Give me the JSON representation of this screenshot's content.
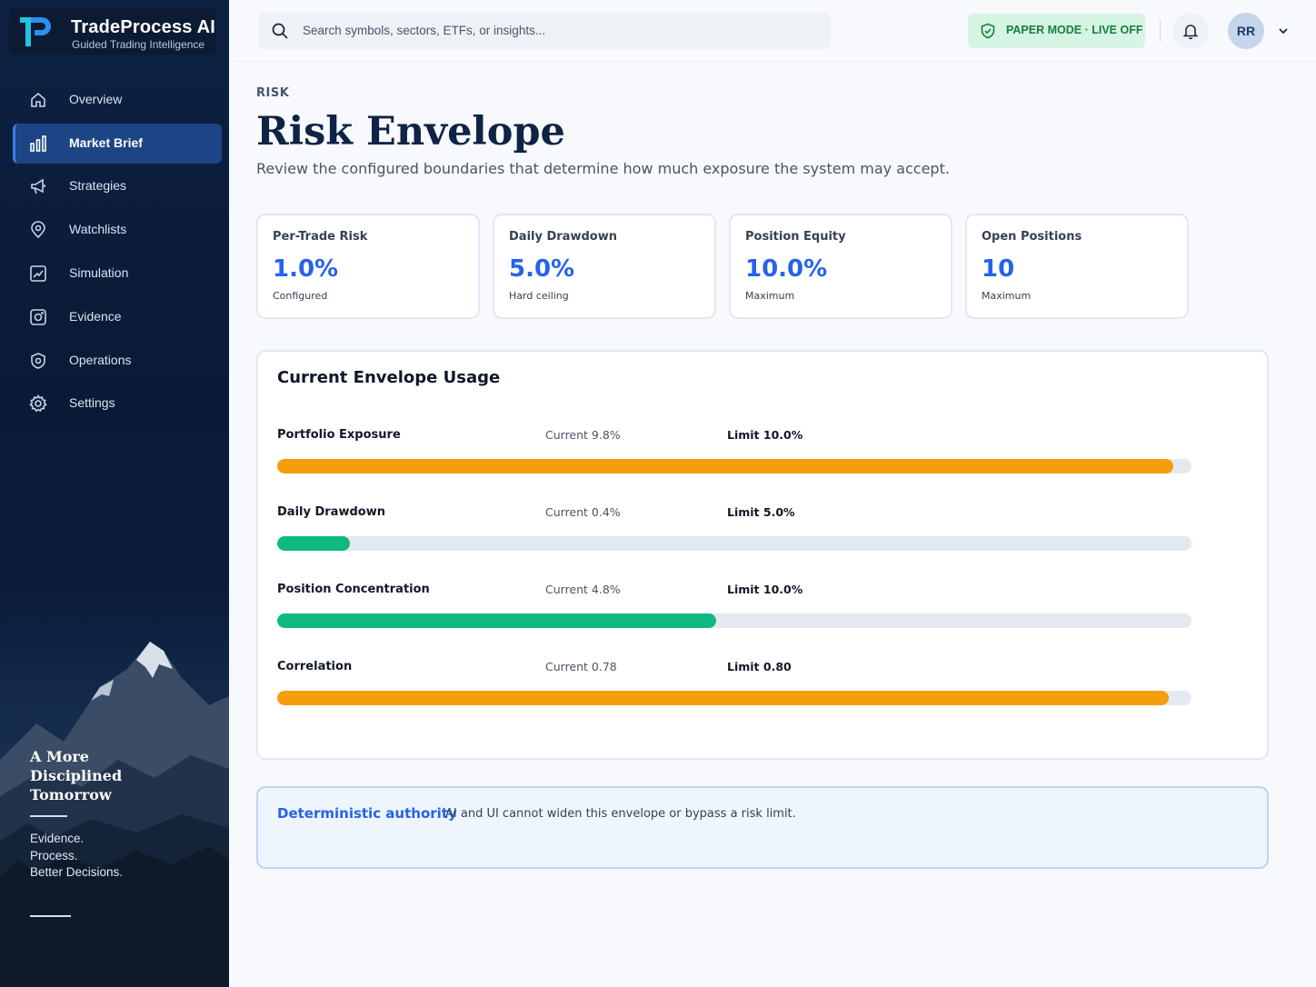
{
  "app": {
    "name": "TradeProcess AI",
    "tagline": "Guided Trading Intelligence"
  },
  "sidebar": {
    "items": [
      {
        "label": "Overview",
        "icon": "home-icon"
      },
      {
        "label": "Market Brief",
        "icon": "bar-chart-icon",
        "active": true
      },
      {
        "label": "Strategies",
        "icon": "megaphone-icon"
      },
      {
        "label": "Watchlists",
        "icon": "map-pin-icon"
      },
      {
        "label": "Simulation",
        "icon": "chart-frame-icon"
      },
      {
        "label": "Evidence",
        "icon": "camera-icon"
      },
      {
        "label": "Operations",
        "icon": "shield-gear-icon"
      },
      {
        "label": "Settings",
        "icon": "gear-icon"
      }
    ],
    "promo_title": "A More Disciplined Tomorrow",
    "promo_lines": [
      "Evidence.",
      "Process.",
      "Better Decisions."
    ]
  },
  "header": {
    "search_placeholder": "Search symbols, sectors, ETFs, or insights...",
    "mode_badge": "PAPER MODE · LIVE OFF",
    "avatar_initials": "RR"
  },
  "page": {
    "eyebrow": "RISK",
    "title": "Risk Envelope",
    "subtitle": "Review the configured boundaries that determine how much exposure the system may accept."
  },
  "stats": [
    {
      "label": "Per-Trade Risk",
      "value": "1.0%",
      "note": "Configured"
    },
    {
      "label": "Daily Drawdown",
      "value": "5.0%",
      "note": "Hard ceiling"
    },
    {
      "label": "Position Equity",
      "value": "10.0%",
      "note": "Maximum"
    },
    {
      "label": "Open Positions",
      "value": "10",
      "note": "Maximum"
    }
  ],
  "usage": {
    "title": "Current Envelope Usage",
    "metrics": [
      {
        "name": "Portfolio Exposure",
        "current": "Current 9.8%",
        "limit": "Limit 10.0%",
        "ratio": 0.98,
        "status": "warning"
      },
      {
        "name": "Daily Drawdown",
        "current": "Current 0.4%",
        "limit": "Limit 5.0%",
        "ratio": 0.08,
        "status": "ok"
      },
      {
        "name": "Position Concentration",
        "current": "Current 4.8%",
        "limit": "Limit 10.0%",
        "ratio": 0.48,
        "status": "ok"
      },
      {
        "name": "Correlation",
        "current": "Current 0.78",
        "limit": "Limit 0.80",
        "ratio": 0.975,
        "status": "warning"
      }
    ]
  },
  "notice": {
    "title": "Deterministic authority",
    "text": "AI and UI cannot widen this envelope or bypass a risk limit."
  },
  "colors": {
    "accent": "#2563eb",
    "warning": "#f59e0b",
    "ok": "#10b981",
    "sidebar_bg": "#0b1d3a",
    "badge_green": "#15803d"
  }
}
